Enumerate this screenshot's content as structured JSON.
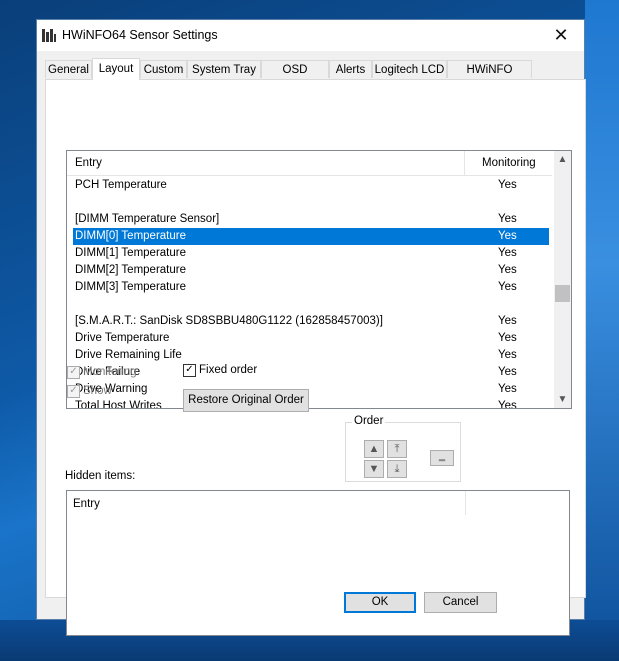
{
  "window": {
    "title": "HWiNFO64 Sensor Settings",
    "close_glyph": "✕"
  },
  "tabs": [
    {
      "label": "General"
    },
    {
      "label": "Layout"
    },
    {
      "label": "Custom"
    },
    {
      "label": "System Tray"
    },
    {
      "label": "OSD (RTSS)"
    },
    {
      "label": "Alerts"
    },
    {
      "label": "Logitech LCD"
    },
    {
      "label": "HWiNFO Gadget"
    }
  ],
  "active_tab": "Layout",
  "list": {
    "headers": {
      "entry": "Entry",
      "monitoring": "Monitoring"
    },
    "rows": [
      {
        "entry": "PCH Temperature",
        "monitoring": "Yes"
      },
      {
        "entry": "",
        "monitoring": ""
      },
      {
        "entry": "[DIMM Temperature Sensor]",
        "monitoring": "Yes"
      },
      {
        "entry": "DIMM[0] Temperature",
        "monitoring": "Yes",
        "selected": true
      },
      {
        "entry": "DIMM[1] Temperature",
        "monitoring": "Yes"
      },
      {
        "entry": "DIMM[2] Temperature",
        "monitoring": "Yes"
      },
      {
        "entry": "DIMM[3] Temperature",
        "monitoring": "Yes"
      },
      {
        "entry": "",
        "monitoring": ""
      },
      {
        "entry": "[S.M.A.R.T.: SanDisk SD8SBBU480G1122 (162858457003)]",
        "monitoring": "Yes"
      },
      {
        "entry": "Drive Temperature",
        "monitoring": "Yes"
      },
      {
        "entry": "Drive Remaining Life",
        "monitoring": "Yes"
      },
      {
        "entry": "Drive Failure",
        "monitoring": "Yes"
      },
      {
        "entry": "Drive Warning",
        "monitoring": "Yes"
      },
      {
        "entry": "Total Host Writes",
        "monitoring": "Yes"
      }
    ]
  },
  "options": {
    "monitoring": {
      "label": "Monitoring",
      "checked": true,
      "enabled": false
    },
    "show": {
      "label": "Show",
      "checked": true,
      "enabled": false
    },
    "fixed_order": {
      "label": "Fixed order",
      "checked": true,
      "enabled": true
    },
    "restore_label": "Restore Original Order"
  },
  "order": {
    "label": "Order",
    "move_top_icon": "arrow-up-to-top",
    "move_up_icon": "arrow-up",
    "move_down_icon": "arrow-down",
    "move_bottom_icon": "arrow-down-to-bottom",
    "extra_label": "..."
  },
  "hidden": {
    "label": "Hidden items:",
    "header": "Entry"
  },
  "footer": {
    "ok": "OK",
    "cancel": "Cancel"
  },
  "colors": {
    "selection": "#0078d7",
    "default_button_border": "#0078d7"
  }
}
